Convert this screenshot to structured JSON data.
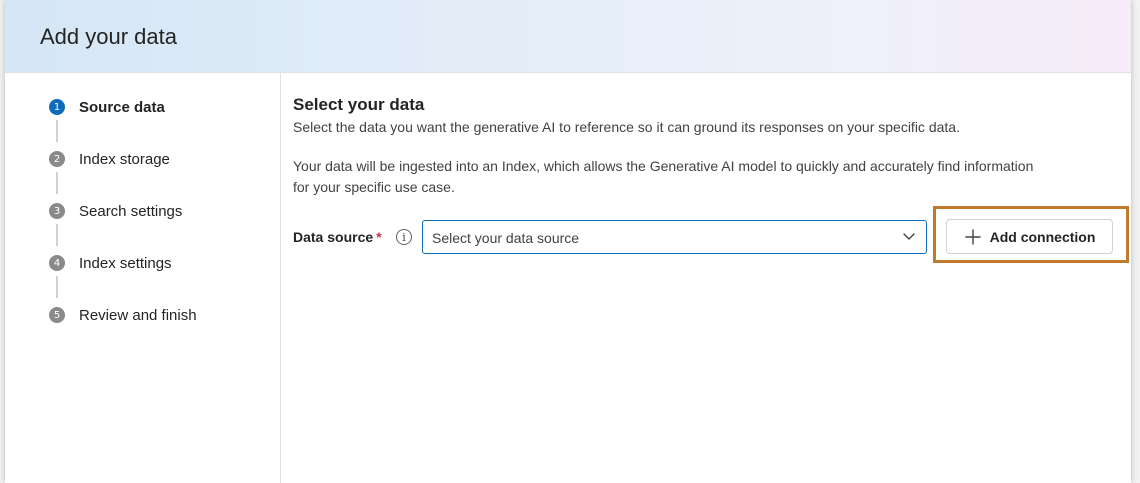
{
  "dialog": {
    "title": "Add your data"
  },
  "wizard": {
    "steps": [
      {
        "number": "1",
        "label": "Source data",
        "active": true
      },
      {
        "number": "2",
        "label": "Index storage",
        "active": false
      },
      {
        "number": "3",
        "label": "Search settings",
        "active": false
      },
      {
        "number": "4",
        "label": "Index settings",
        "active": false
      },
      {
        "number": "5",
        "label": "Review and finish",
        "active": false
      }
    ]
  },
  "content": {
    "section_title": "Select your data",
    "description": "Select the data you want the generative AI to reference so it can ground its responses on your specific data.",
    "description2": "Your data will be ingested into an Index, which allows the Generative AI model to quickly and accurately find information for your specific use case.",
    "data_source": {
      "label": "Data source",
      "required_mark": "*",
      "info_glyph": "i",
      "placeholder": "Select your data source"
    },
    "add_connection_label": "Add connection"
  },
  "colors": {
    "accent": "#0f6cbd",
    "highlight": "#c07a2b",
    "required": "#c4314b"
  },
  "icons": {
    "info": "info-icon",
    "chevron": "chevron-down-icon",
    "add": "plus-icon"
  }
}
